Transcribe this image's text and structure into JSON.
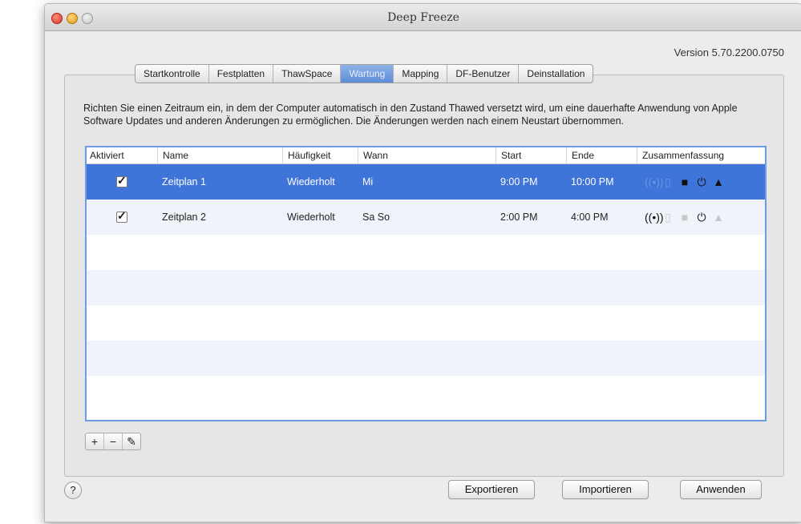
{
  "window": {
    "title": "Deep Freeze",
    "version": "Version 5.70.2200.0750"
  },
  "tabs": [
    {
      "label": "Startkontrolle"
    },
    {
      "label": "Festplatten"
    },
    {
      "label": "ThawSpace"
    },
    {
      "label": "Wartung",
      "active": true
    },
    {
      "label": "Mapping"
    },
    {
      "label": "DF-Benutzer"
    },
    {
      "label": "Deinstallation"
    }
  ],
  "description": "Richten Sie einen Zeitraum ein, in dem der Computer automatisch in den Zustand Thawed versetzt wird, um eine dauerhafte Anwendung von Apple Software Updates und anderen Änderungen zu ermöglichen. Die Änderungen werden nach einem Neustart übernommen.",
  "table": {
    "columns": [
      "Aktiviert",
      "Name",
      "Häufigkeit",
      "Wann",
      "Start",
      "Ende",
      "Zusammenfassung"
    ],
    "rows": [
      {
        "enabled": true,
        "name": "Zeitplan 1",
        "frequency": "Wiederholt",
        "when": "Mi",
        "start": "9:00 PM",
        "end": "10:00 PM",
        "selected": true,
        "summary_icons": [
          "broadcast-icon",
          "document-icon",
          "lock-icon",
          "power-icon",
          "warning-icon"
        ]
      },
      {
        "enabled": true,
        "name": "Zeitplan 2",
        "frequency": "Wiederholt",
        "when": "Sa So",
        "start": "2:00 PM",
        "end": "4:00 PM",
        "selected": false,
        "summary_icons": [
          "broadcast-icon",
          "document-icon",
          "lock-icon",
          "power-icon",
          "warning-icon"
        ]
      }
    ]
  },
  "toolbar": {
    "add": "+",
    "remove": "−",
    "edit": "✎"
  },
  "help": "?",
  "buttons": {
    "export": "Exportieren",
    "import": "Importieren",
    "apply": "Anwenden"
  },
  "colors": {
    "selection": "#3f74d8",
    "table_border": "#6f9be3",
    "active_tab": "#5c8cd6"
  }
}
